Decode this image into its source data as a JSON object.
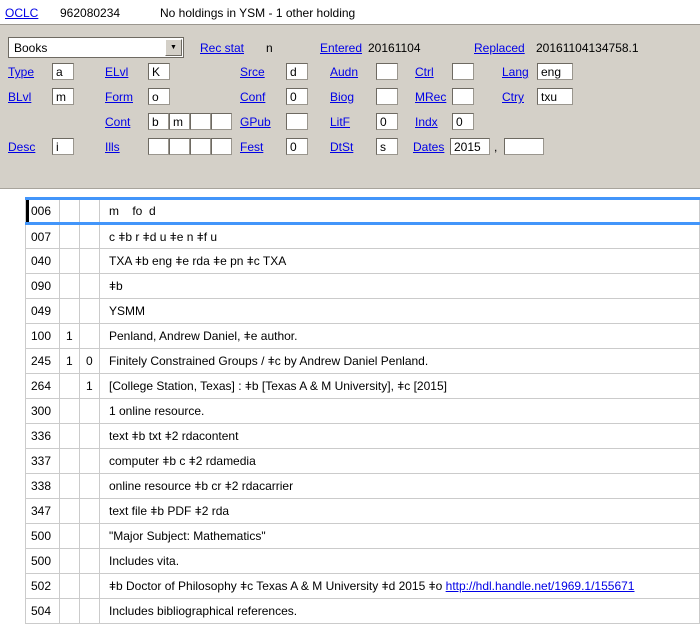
{
  "header": {
    "oclc": "OCLC",
    "control_number": "962080234",
    "holdings": "No holdings in YSM - 1 other holding"
  },
  "fixed": {
    "format": "Books",
    "labels": {
      "rec_stat": "Rec stat",
      "entered": "Entered",
      "replaced": "Replaced",
      "type": "Type",
      "elvl": "ELvl",
      "srce": "Srce",
      "audn": "Audn",
      "ctrl": "Ctrl",
      "lang": "Lang",
      "blvl": "BLvl",
      "form": "Form",
      "conf": "Conf",
      "biog": "Biog",
      "mrec": "MRec",
      "ctry": "Ctry",
      "cont": "Cont",
      "gpub": "GPub",
      "litf": "LitF",
      "indx": "Indx",
      "desc": "Desc",
      "ills": "Ills",
      "fest": "Fest",
      "dtst": "DtSt",
      "dates": "Dates"
    },
    "values": {
      "rec_stat": "n",
      "entered": "20161104",
      "replaced": "20161104134758.1",
      "type": "a",
      "elvl": "K",
      "srce": "d",
      "audn": "",
      "ctrl": "",
      "lang": "eng",
      "blvl": "m",
      "form": "o",
      "conf": "0",
      "biog": "",
      "mrec": "",
      "ctry": "txu",
      "cont1": "b",
      "cont2": "m",
      "cont3": "",
      "cont4": "",
      "gpub": "",
      "litf": "0",
      "indx": "0",
      "desc": "i",
      "ills1": "",
      "ills2": "",
      "ills3": "",
      "ills4": "",
      "fest": "0",
      "dtst": "s",
      "date1": "2015",
      "dates_separator": ",",
      "date2": ""
    }
  },
  "marc": {
    "selected_index": 0,
    "rows": [
      {
        "tag": "006",
        "ind1": "",
        "ind2": "",
        "content": "m    fo  d"
      },
      {
        "tag": "007",
        "ind1": "",
        "ind2": "",
        "content": "c ǂb r ǂd u ǂe n ǂf u"
      },
      {
        "tag": "040",
        "ind1": "",
        "ind2": "",
        "content": "TXA ǂb eng ǂe rda ǂe pn ǂc TXA"
      },
      {
        "tag": "090",
        "ind1": "",
        "ind2": "",
        "content": "ǂb"
      },
      {
        "tag": "049",
        "ind1": "",
        "ind2": "",
        "content": "YSMM"
      },
      {
        "tag": "100",
        "ind1": "1",
        "ind2": "",
        "content": "Penland, Andrew Daniel, ǂe author."
      },
      {
        "tag": "245",
        "ind1": "1",
        "ind2": "0",
        "content": "Finitely Constrained Groups / ǂc by Andrew Daniel Penland."
      },
      {
        "tag": "264",
        "ind1": "",
        "ind2": "1",
        "content": "[College Station, Texas] : ǂb [Texas A & M University], ǂc [2015]"
      },
      {
        "tag": "300",
        "ind1": "",
        "ind2": "",
        "content": "1 online resource."
      },
      {
        "tag": "336",
        "ind1": "",
        "ind2": "",
        "content": "text ǂb txt ǂ2 rdacontent"
      },
      {
        "tag": "337",
        "ind1": "",
        "ind2": "",
        "content": "computer ǂb c ǂ2 rdamedia"
      },
      {
        "tag": "338",
        "ind1": "",
        "ind2": "",
        "content": "online resource ǂb cr ǂ2 rdacarrier"
      },
      {
        "tag": "347",
        "ind1": "",
        "ind2": "",
        "content": "text file ǂb PDF ǂ2 rda"
      },
      {
        "tag": "500",
        "ind1": "",
        "ind2": "",
        "content": "\"Major Subject: Mathematics\""
      },
      {
        "tag": "500",
        "ind1": "",
        "ind2": "",
        "content": "Includes vita."
      },
      {
        "tag": "502",
        "ind1": "",
        "ind2": "",
        "content": "ǂb Doctor of Philosophy ǂc Texas A & M University ǂd 2015 ǂo ",
        "link": "http://hdl.handle.net/1969.1/155671"
      },
      {
        "tag": "504",
        "ind1": "",
        "ind2": "",
        "content": "Includes bibliographical references."
      }
    ]
  },
  "colors": {
    "link": "#0000e6",
    "panel_bg": "#d4d0c8",
    "selected_row_border": "#4295fa",
    "grid_line": "#cbcbcb"
  }
}
